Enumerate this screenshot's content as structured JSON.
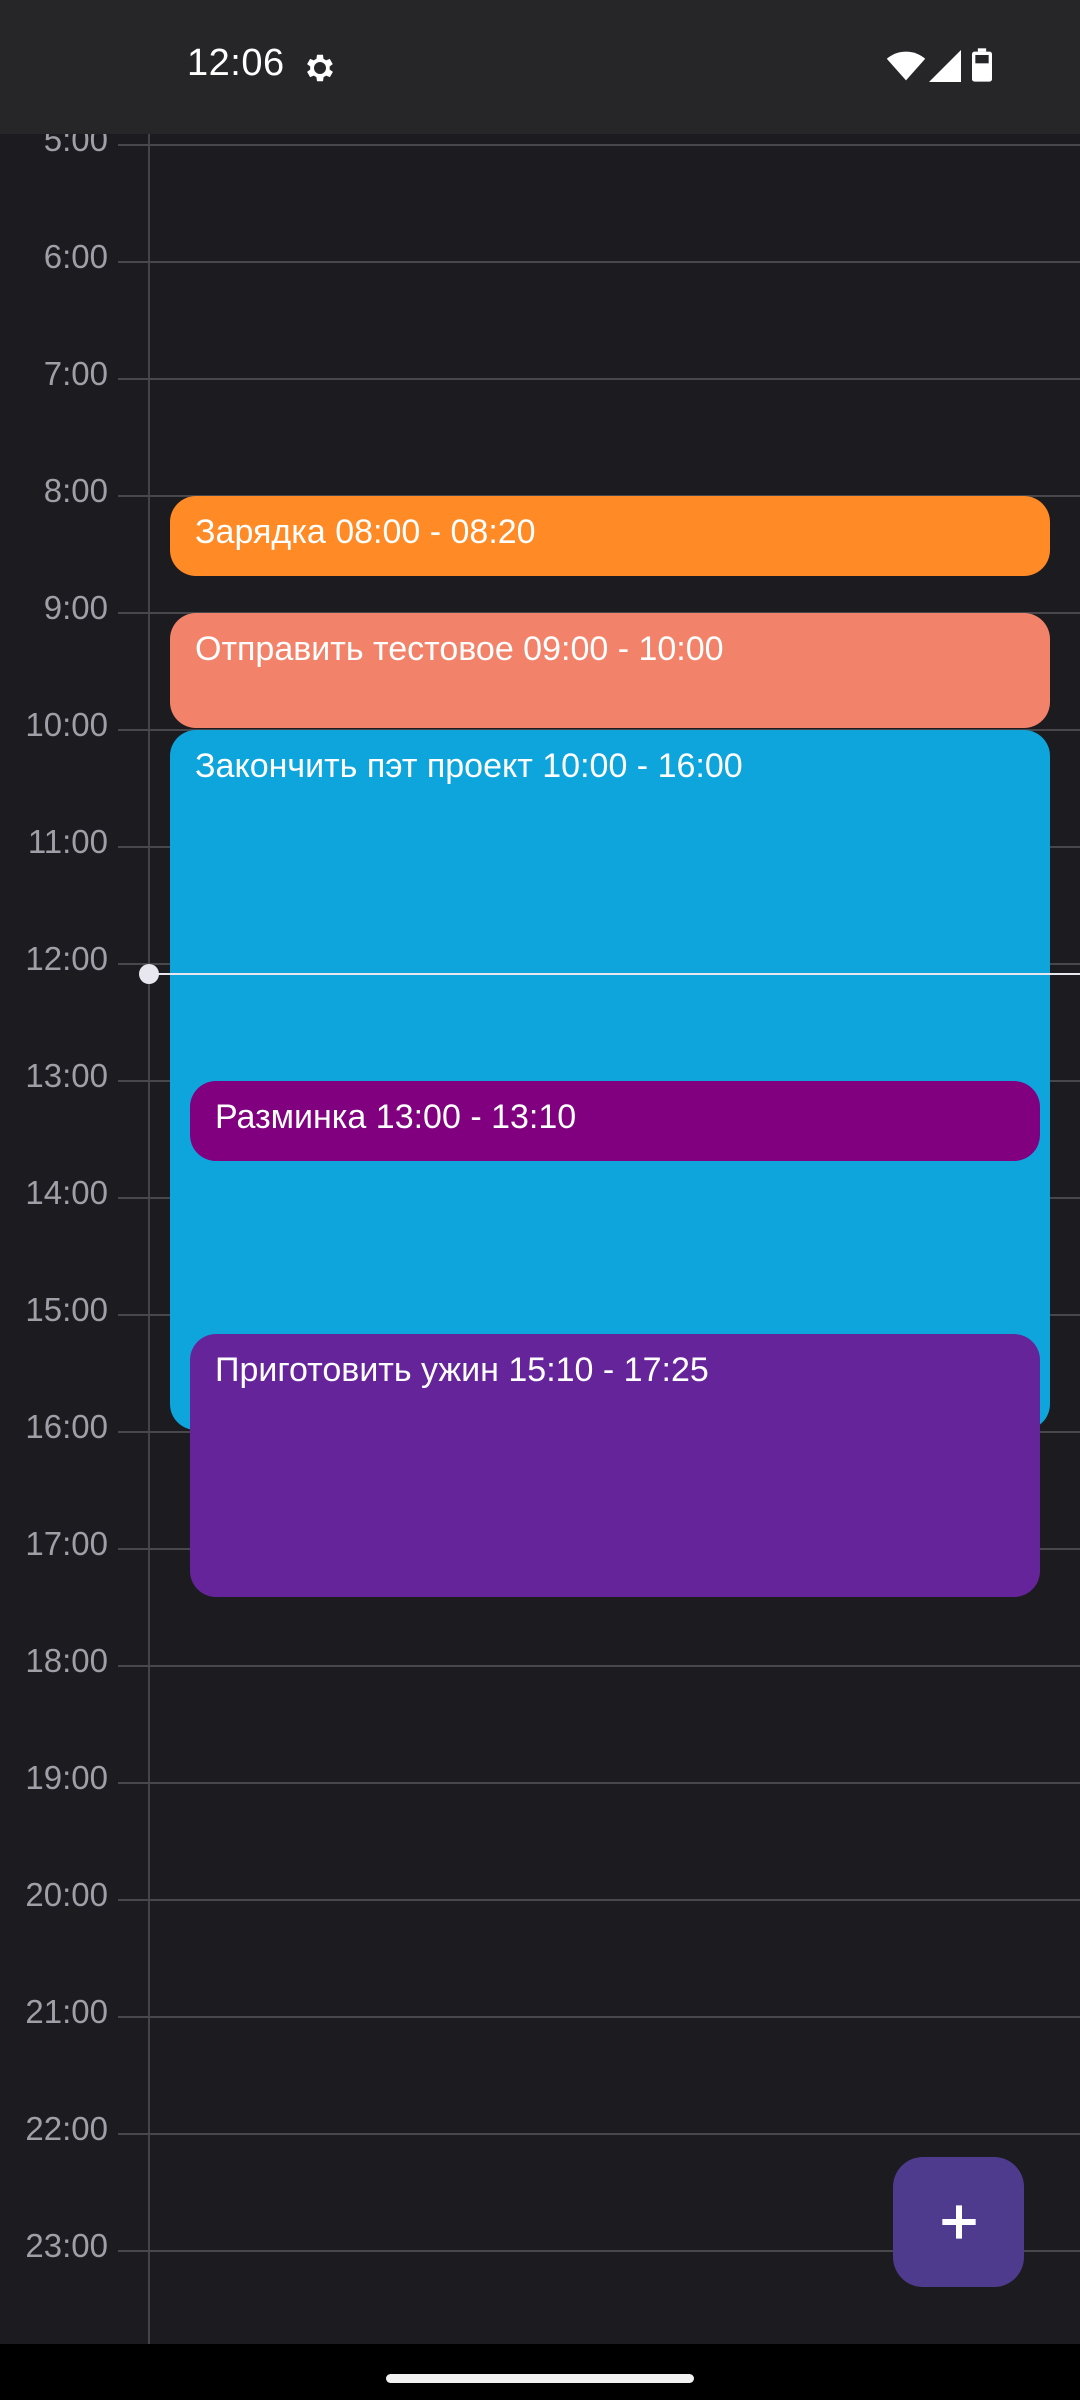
{
  "status_bar": {
    "time": "12:06",
    "icons": [
      "gear-icon",
      "wifi-icon",
      "signal-icon",
      "battery-icon"
    ]
  },
  "timeline": {
    "hours": [
      "5:00",
      "6:00",
      "7:00",
      "8:00",
      "9:00",
      "10:00",
      "11:00",
      "12:00",
      "13:00",
      "14:00",
      "15:00",
      "16:00",
      "17:00",
      "18:00",
      "19:00",
      "20:00",
      "21:00",
      "22:00",
      "23:00"
    ],
    "current_time_indicator": "12:06"
  },
  "events": [
    {
      "label": "Зарядка 08:00 - 08:20",
      "color": "#ff8a26"
    },
    {
      "label": "Отправить тестовое 09:00 - 10:00",
      "color": "#f2836a"
    },
    {
      "label": "Закончить пэт проект 10:00 - 16:00",
      "color": "#0ea5dd"
    },
    {
      "label": "Разминка 13:00 - 13:10",
      "color": "#800080"
    },
    {
      "label": "Приготовить ужин 15:10 - 17:25",
      "color": "#66249a"
    }
  ],
  "fab": {
    "icon": "plus-icon",
    "color": "#4e3b8e"
  },
  "colors": {
    "background": "#1c1b1f",
    "status_bar": "#262629",
    "grid_line": "#48474c",
    "hour_text": "#a09ea6"
  }
}
